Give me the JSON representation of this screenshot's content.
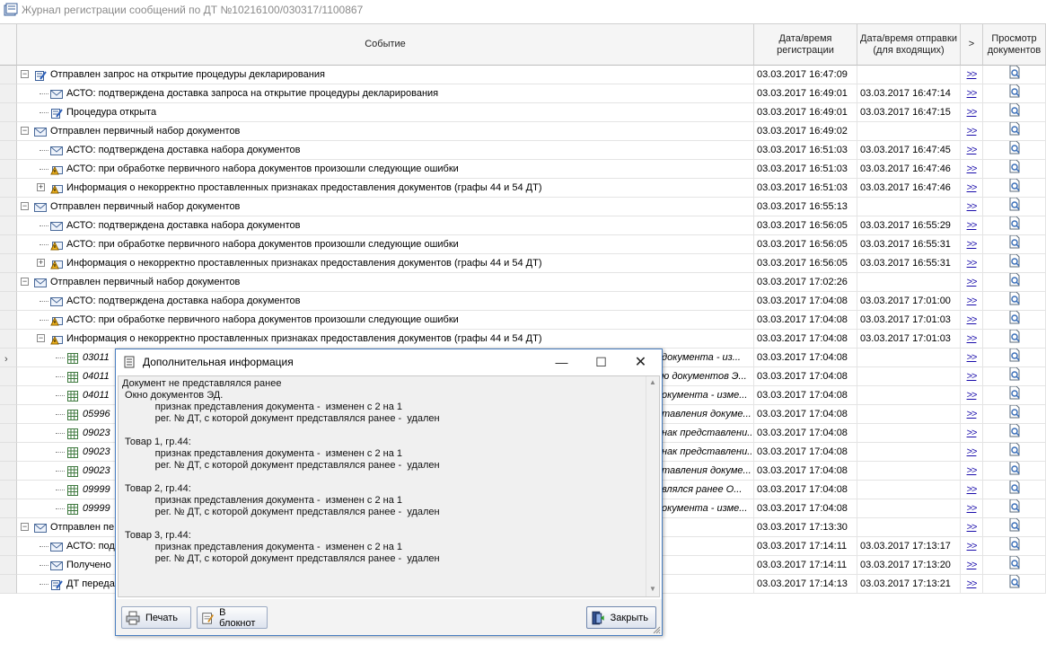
{
  "window": {
    "title": "Журнал регистрации сообщений по ДТ №10216100/030317/1100867"
  },
  "columns": {
    "event": "Событие",
    "reg_date": "Дата/время регистрации",
    "sent_date": "Дата/время отправки (для входящих)",
    "link": ">",
    "view": "Просмотр документов"
  },
  "link_symbol": ">>",
  "rows": [
    {
      "event": "Отправлен запрос на открытие процедуры декларирования",
      "reg": "03.03.2017 16:47:09",
      "sent": "",
      "level": 0,
      "expander": "−",
      "icon": "edit-doc-icon"
    },
    {
      "event": "АСТО: подтверждена доставка запроса на открытие процедуры декларирования",
      "reg": "03.03.2017 16:49:01",
      "sent": "03.03.2017 16:47:14",
      "level": 1,
      "expander": "",
      "icon": "envelope-icon"
    },
    {
      "event": "Процедура открыта",
      "reg": "03.03.2017 16:49:01",
      "sent": "03.03.2017 16:47:15",
      "level": 1,
      "expander": "",
      "icon": "edit-doc-icon"
    },
    {
      "event": "Отправлен первичный набор документов",
      "reg": "03.03.2017 16:49:02",
      "sent": "",
      "level": 0,
      "expander": "−",
      "icon": "envelope-icon"
    },
    {
      "event": "АСТО: подтверждена доставка набора документов",
      "reg": "03.03.2017 16:51:03",
      "sent": "03.03.2017 16:47:45",
      "level": 1,
      "expander": "",
      "icon": "envelope-icon"
    },
    {
      "event": "АСТО: при обработке первичного набора документов произошли следующие ошибки",
      "reg": "03.03.2017 16:51:03",
      "sent": "03.03.2017 16:47:46",
      "level": 1,
      "expander": "",
      "icon": "warning-envelope-icon"
    },
    {
      "event": "Информация о некорректно проставленных признаках предоставления документов (графы 44 и 54 ДТ)",
      "reg": "03.03.2017 16:51:03",
      "sent": "03.03.2017 16:47:46",
      "level": 1,
      "expander": "+",
      "icon": "warning-envelope-icon"
    },
    {
      "event": "Отправлен первичный набор документов",
      "reg": "03.03.2017 16:55:13",
      "sent": "",
      "level": 0,
      "expander": "−",
      "icon": "envelope-icon"
    },
    {
      "event": "АСТО: подтверждена доставка набора документов",
      "reg": "03.03.2017 16:56:05",
      "sent": "03.03.2017 16:55:29",
      "level": 1,
      "expander": "",
      "icon": "envelope-icon"
    },
    {
      "event": "АСТО: при обработке первичного набора документов произошли следующие ошибки",
      "reg": "03.03.2017 16:56:05",
      "sent": "03.03.2017 16:55:31",
      "level": 1,
      "expander": "",
      "icon": "warning-envelope-icon"
    },
    {
      "event": "Информация о некорректно проставленных признаках предоставления документов (графы 44 и 54 ДТ)",
      "reg": "03.03.2017 16:56:05",
      "sent": "03.03.2017 16:55:31",
      "level": 1,
      "expander": "+",
      "icon": "warning-envelope-icon"
    },
    {
      "event": "Отправлен первичный набор документов",
      "reg": "03.03.2017 17:02:26",
      "sent": "",
      "level": 0,
      "expander": "−",
      "icon": "envelope-icon"
    },
    {
      "event": "АСТО: подтверждена доставка набора документов",
      "reg": "03.03.2017 17:04:08",
      "sent": "03.03.2017 17:01:00",
      "level": 1,
      "expander": "",
      "icon": "envelope-icon"
    },
    {
      "event": "АСТО: при обработке первичного набора документов произошли следующие ошибки",
      "reg": "03.03.2017 17:04:08",
      "sent": "03.03.2017 17:01:03",
      "level": 1,
      "expander": "",
      "icon": "warning-envelope-icon"
    },
    {
      "event": "Информация о некорректно проставленных признаках предоставления документов (графы 44 и 54 ДТ)",
      "reg": "03.03.2017 17:04:08",
      "sent": "03.03.2017 17:01:03",
      "level": 1,
      "expander": "−",
      "icon": "warning-envelope-icon"
    },
    {
      "event": "03011",
      "tail": "документа - из...",
      "reg": "03.03.2017 17:04:08",
      "sent": "",
      "level": 2,
      "expander": "",
      "icon": "table-icon",
      "italic": true
    },
    {
      "event": "04011",
      "tail": "ю документов Э...",
      "reg": "03.03.2017 17:04:08",
      "sent": "",
      "level": 2,
      "expander": "",
      "icon": "table-icon",
      "italic": true
    },
    {
      "event": "04011",
      "tail": "окумента - изме...",
      "reg": "03.03.2017 17:04:08",
      "sent": "",
      "level": 2,
      "expander": "",
      "icon": "table-icon",
      "italic": true
    },
    {
      "event": "05996",
      "tail": "тавления докуме...",
      "reg": "03.03.2017 17:04:08",
      "sent": "",
      "level": 2,
      "expander": "",
      "icon": "table-icon",
      "italic": true
    },
    {
      "event": "09023",
      "tail": "нак представлени...",
      "reg": "03.03.2017 17:04:08",
      "sent": "",
      "level": 2,
      "expander": "",
      "icon": "table-icon",
      "italic": true
    },
    {
      "event": "09023",
      "tail": "нак представлени...",
      "reg": "03.03.2017 17:04:08",
      "sent": "",
      "level": 2,
      "expander": "",
      "icon": "table-icon",
      "italic": true
    },
    {
      "event": "09023",
      "tail": "тавления докуме...",
      "reg": "03.03.2017 17:04:08",
      "sent": "",
      "level": 2,
      "expander": "",
      "icon": "table-icon",
      "italic": true
    },
    {
      "event": "09999",
      "tail": "влялся ранее  О...",
      "reg": "03.03.2017 17:04:08",
      "sent": "",
      "level": 2,
      "expander": "",
      "icon": "table-icon",
      "italic": true
    },
    {
      "event": "09999",
      "tail": "окумента - изме...",
      "reg": "03.03.2017 17:04:08",
      "sent": "",
      "level": 2,
      "expander": "",
      "icon": "table-icon",
      "italic": true
    },
    {
      "event": "Отправлен пе",
      "reg": "03.03.2017 17:13:30",
      "sent": "",
      "level": 0,
      "expander": "−",
      "icon": "envelope-icon"
    },
    {
      "event": "АСТО: под",
      "reg": "03.03.2017 17:14:11",
      "sent": "03.03.2017 17:13:17",
      "level": 1,
      "expander": "",
      "icon": "envelope-icon"
    },
    {
      "event": "Получено",
      "reg": "03.03.2017 17:14:11",
      "sent": "03.03.2017 17:13:20",
      "level": 1,
      "expander": "",
      "icon": "envelope-icon"
    },
    {
      "event": "ДТ переда",
      "reg": "03.03.2017 17:14:13",
      "sent": "03.03.2017 17:13:21",
      "level": 1,
      "expander": "",
      "icon": "edit-doc-icon"
    }
  ],
  "dialog": {
    "title": "Дополнительная информация",
    "text": "Документ не представлялся ранее\n Окно документов ЭД.\n            признак представления документа -  изменен с 2 на 1\n            рег. № ДТ, с которой документ представлялся ранее -  удален\n\n Товар 1, гр.44:\n            признак представления документа -  изменен с 2 на 1\n            рег. № ДТ, с которой документ представлялся ранее -  удален\n\n Товар 2, гр.44:\n            признак представления документа -  изменен с 2 на 1\n            рег. № ДТ, с которой документ представлялся ранее -  удален\n\n Товар 3, гр.44:\n            признак представления документа -  изменен с 2 на 1\n            рег. № ДТ, с которой документ представлялся ранее -  удален",
    "buttons": {
      "print": "Печать",
      "notepad": "В блокнот",
      "close": "Закрыть"
    }
  },
  "colors": {
    "link": "#1a0dab",
    "dialog_border": "#4a7fc1",
    "header_bg": "#f5f5f5"
  }
}
